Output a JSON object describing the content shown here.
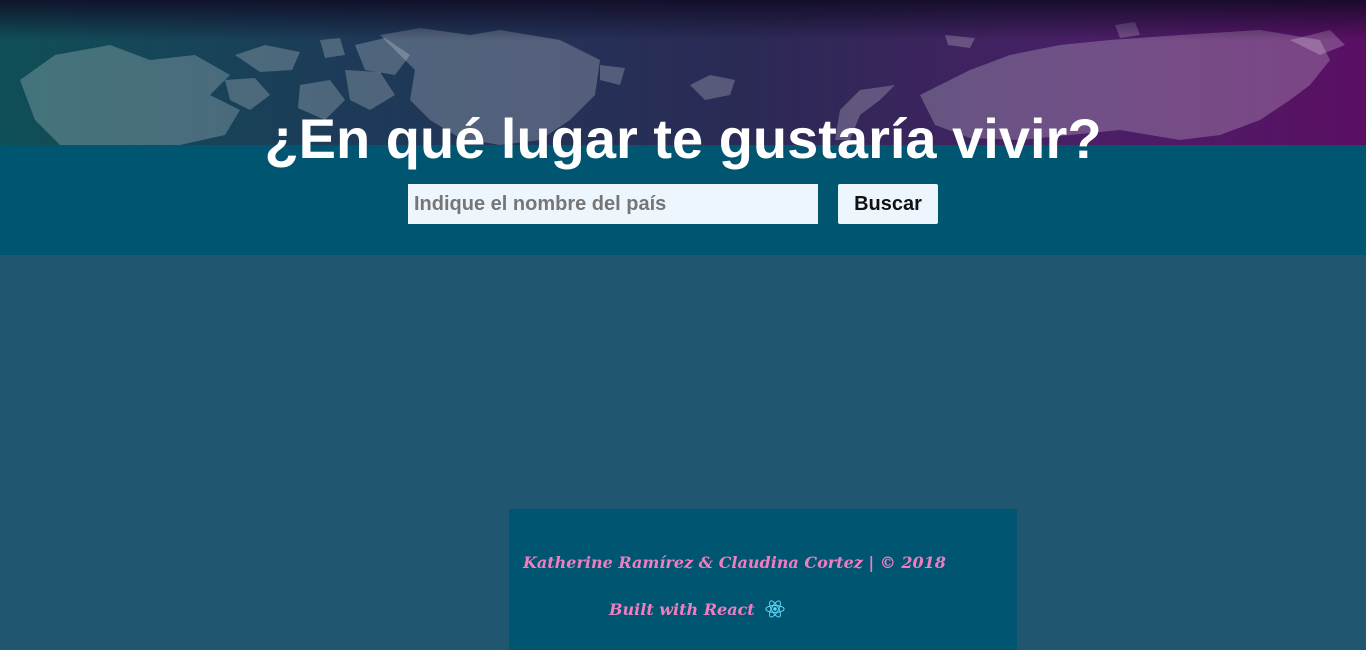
{
  "hero": {
    "title": "¿En qué lugar te gustaría vivir?"
  },
  "search": {
    "placeholder": "Indique el nombre del país",
    "value": "",
    "button_label": "Buscar"
  },
  "footer": {
    "credits": "Katherine Ramírez & Claudina Cortez | © 2018",
    "built_with": "Built with React",
    "icon": "react-logo-icon"
  },
  "colors": {
    "page_background": "#215670",
    "band_background": "#005671",
    "accent_pink": "#f07dc0",
    "react_blue": "#61dafb"
  }
}
